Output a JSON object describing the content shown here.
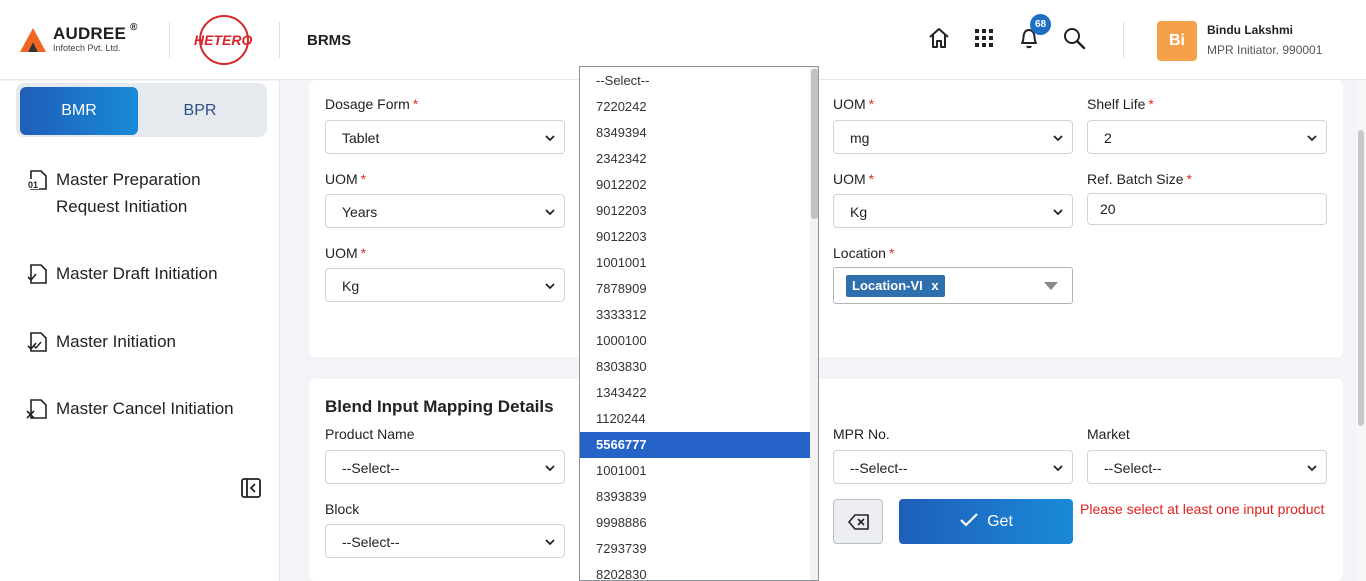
{
  "header": {
    "brand_name": "AUDREE",
    "brand_reg": "®",
    "brand_sub": "Infotech Pvt. Ltd.",
    "partner_logo": "HETERO",
    "app_name": "BRMS",
    "notif_count": "68",
    "user": {
      "initials": "Bi",
      "name": "Bindu Lakshmi",
      "role": "MPR Initiator. 990001"
    }
  },
  "sidebar": {
    "tabs": [
      {
        "label": "BMR"
      },
      {
        "label": "BPR"
      }
    ],
    "items": [
      {
        "label": "Master Preparation Request Initiation",
        "icon": "document-01-icon"
      },
      {
        "label": "Master Draft Initiation",
        "icon": "document-check-icon"
      },
      {
        "label": "Master Initiation",
        "icon": "document-double-check-icon"
      },
      {
        "label": "Master Cancel Initiation",
        "icon": "document-cancel-icon"
      }
    ]
  },
  "form_top": {
    "dosage_form": {
      "label": "Dosage Form",
      "value": "Tablet"
    },
    "uom_years": {
      "label": "UOM",
      "value": "Years"
    },
    "uom_kg_left": {
      "label": "UOM",
      "value": "Kg"
    },
    "uom_mg": {
      "label": "UOM",
      "value": "mg"
    },
    "uom_kg_right": {
      "label": "UOM",
      "value": "Kg"
    },
    "location": {
      "label": "Location",
      "chip": "Location-VI",
      "chip_remove": "x"
    },
    "shelf_life": {
      "label": "Shelf Life",
      "value": "2"
    },
    "ref_batch_size": {
      "label": "Ref. Batch Size",
      "value": "20"
    }
  },
  "blend": {
    "title": "Blend Input Mapping Details",
    "product_name": {
      "label": "Product Name",
      "value": "--Select--"
    },
    "block": {
      "label": "Block",
      "value": "--Select--"
    },
    "mpr_no": {
      "label": "MPR No.",
      "value": "--Select--"
    },
    "market": {
      "label": "Market",
      "value": "--Select--"
    },
    "get_label": "Get",
    "error": "Please select at least one input product"
  },
  "dropdown": {
    "selected_index": 14,
    "options": [
      "--Select--",
      "7220242",
      "8349394",
      "2342342",
      "9012202",
      "9012203",
      "9012203",
      "1001001",
      "7878909",
      "3333312",
      "1000100",
      "8303830",
      "1343422",
      "1120244",
      "5566777",
      "1001001",
      "8393839",
      "9998886",
      "7293739",
      "8202830"
    ]
  },
  "colors": {
    "accent": "#1e5eb8",
    "selected": "#2563c9",
    "required": "#d93025",
    "error": "#e02020",
    "avatar": "#f5a04b"
  }
}
